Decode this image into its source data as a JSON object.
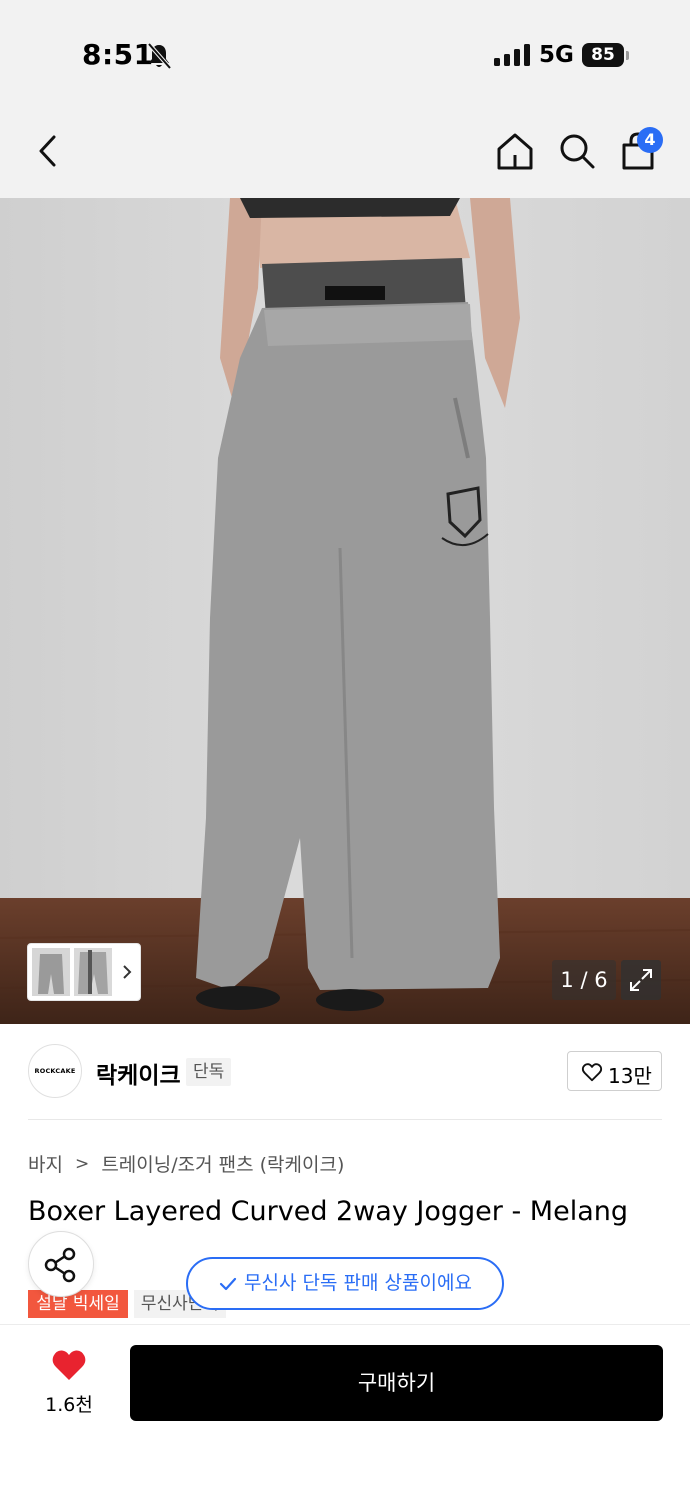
{
  "status_bar": {
    "time": "8:51",
    "network": "5G",
    "battery": "85"
  },
  "nav": {
    "cart_badge": "4"
  },
  "gallery": {
    "counter": "1 / 6"
  },
  "brand": {
    "logo_text": "ROCKCAKE",
    "name": "락케이크",
    "exclusive_label": "단독",
    "like_count": "13만"
  },
  "breadcrumb": {
    "category": "바지",
    "separator": ">",
    "subcategory": "트레이닝/조거 팬츠 (락케이크)"
  },
  "product": {
    "title": "Boxer Layered Curved 2way Jogger - Melang",
    "tags": [
      "설날 빅세일",
      "무신사단독"
    ]
  },
  "toast": {
    "message": "무신사 단독 판매 상품이에요"
  },
  "bottom": {
    "like_count": "1.6천",
    "buy_label": "구매하기"
  },
  "colors": {
    "accent": "#2a6df5",
    "sale": "#f2573e",
    "heart": "#e8232f",
    "buy_button": "#000000"
  }
}
